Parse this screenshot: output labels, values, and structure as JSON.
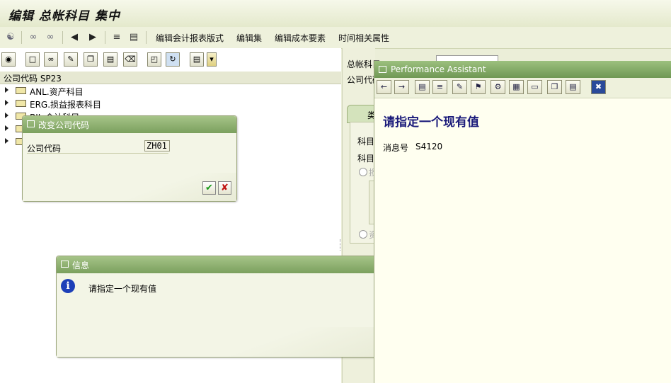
{
  "window": {
    "title": "编辑 总帐科目 集中"
  },
  "app_toolbar": {
    "items": [
      "编辑会计报表版式",
      "编辑集",
      "编辑成本要素",
      "时间相关属性"
    ]
  },
  "left_panel": {
    "header": "公司代码 SP23",
    "tree": [
      "ANL.资产科目",
      "ERG.损益报表科目",
      "BIL.会计科目",
      "",
      ""
    ]
  },
  "right_labels": {
    "gl_account": "总帐科目",
    "company_code": "公司代码"
  },
  "mid_fragments": [
    "类",
    "科目",
    "科目",
    "损",
    "资"
  ],
  "change_cc_dialog": {
    "title": "改变公司代码",
    "label": "公司代码",
    "value": "ZH01"
  },
  "info_dialog": {
    "title": "信息",
    "message": "请指定一个现有值"
  },
  "performance_assistant": {
    "title": "Performance Assistant",
    "heading": "请指定一个现有值",
    "msg_label": "消息号",
    "msg_number": "S4120"
  },
  "colors": {
    "header_green": "#7ba05e",
    "heading_blue": "#1a1a7a",
    "info_blue": "#1c3fb8"
  }
}
